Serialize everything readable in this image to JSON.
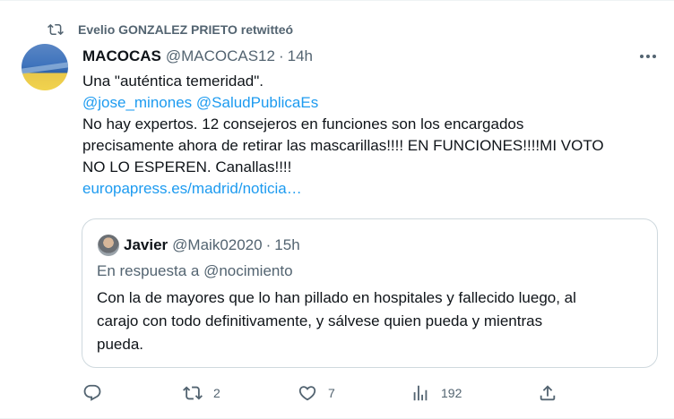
{
  "retweet": {
    "text": "Evelio GONZALEZ PRIETO retwitteó"
  },
  "tweet": {
    "name": "MACOCAS",
    "handle": "@MACOCAS12",
    "separator": "·",
    "time": "14h",
    "lines": [
      "Una \"auténtica temeridad\".",
      "No hay expertos. 12 consejeros en funciones son los encargados",
      "precisamente ahora de retirar las mascarillas!!!! EN FUNCIONES!!!!MI VOTO",
      "NO LO ESPEREN. Canallas!!!!"
    ],
    "mention_1": "@jose_minones",
    "mention_2": "@SaludPublicaEs",
    "link": "europapress.es/madrid/noticia…"
  },
  "quoted": {
    "name": "Javier",
    "handle": "@Maik02020",
    "separator": "·",
    "time": "15h",
    "reply_to": "En respuesta a @nocimiento",
    "lines": [
      "Con la de mayores que lo han pillado en hospitales y fallecido luego, al",
      "carajo con todo definitivamente, y sálvese quien pueda y mientras",
      "pueda."
    ]
  },
  "actions": {
    "reply_icon": "reply-icon",
    "retweet_icon": "retweet-icon",
    "retweets": "2",
    "like_icon": "heart-icon",
    "likes": "7",
    "views_icon": "analytics-icon",
    "views": "192",
    "share_icon": "share-icon"
  },
  "colors": {
    "link": "#1d9bf0",
    "secondary_text": "#536471",
    "primary_text": "#0f1419",
    "border": "#cfd9de"
  }
}
